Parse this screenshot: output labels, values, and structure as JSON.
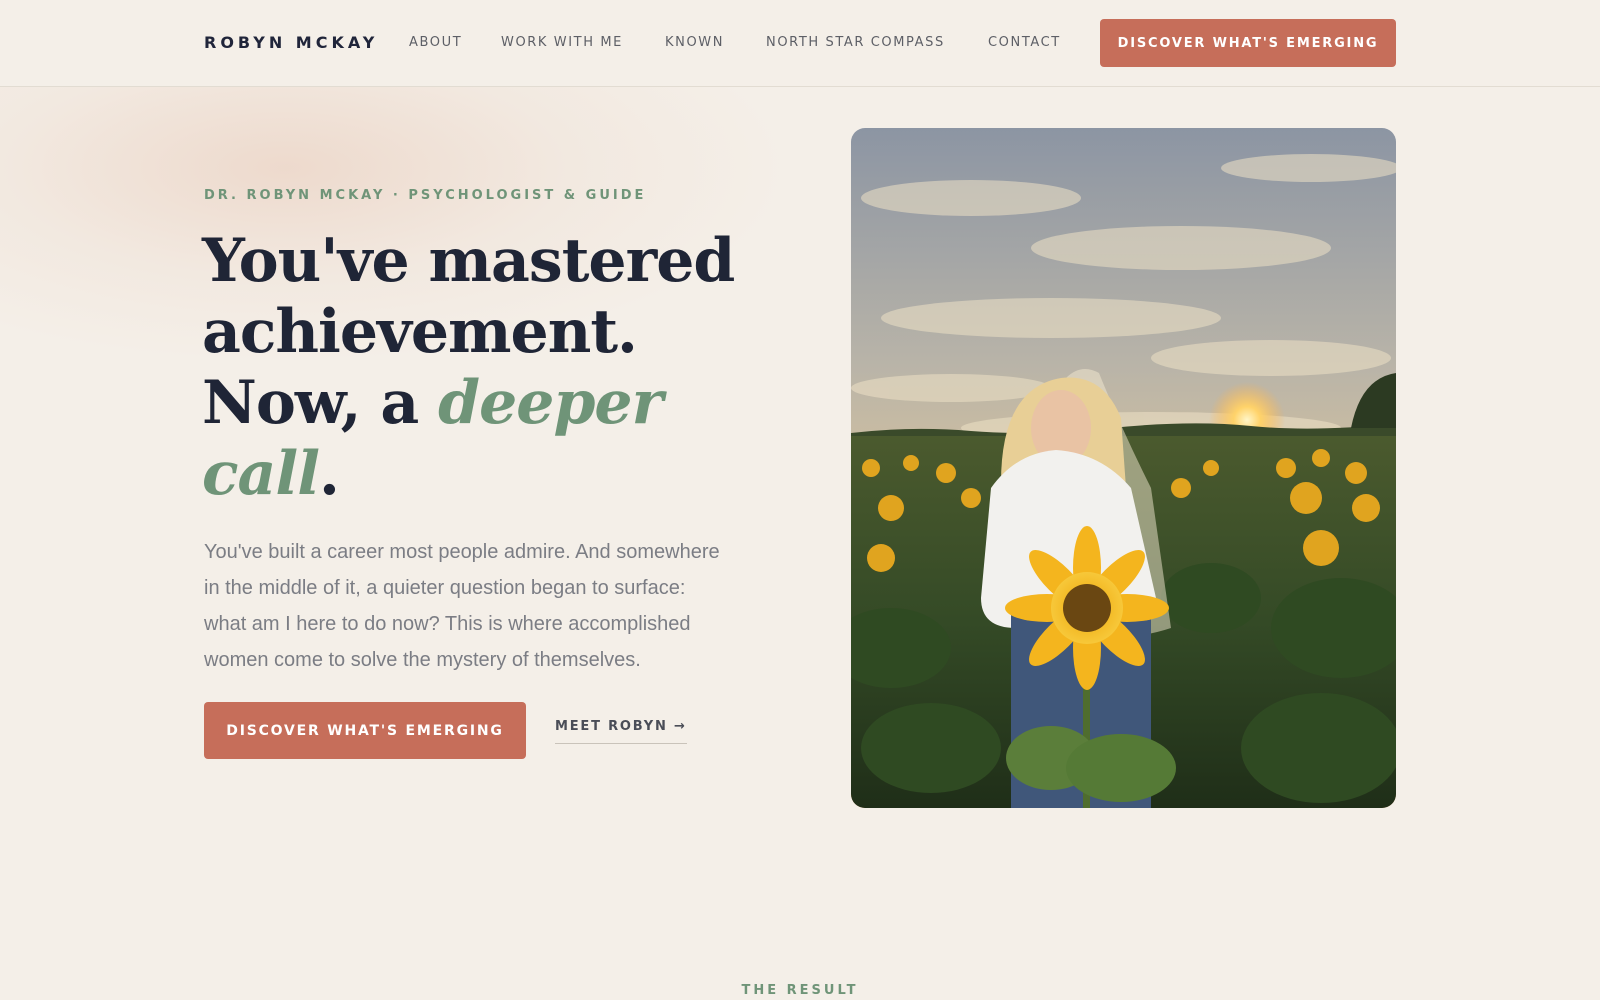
{
  "header": {
    "brand": "ROBYN MCKAY",
    "nav": [
      {
        "label": "ABOUT"
      },
      {
        "label": "WORK WITH ME"
      },
      {
        "label": "KNOWN"
      },
      {
        "label": "NORTH STAR COMPASS"
      },
      {
        "label": "CONTACT"
      }
    ],
    "cta_label": "DISCOVER WHAT'S EMERGING"
  },
  "hero": {
    "eyebrow": "DR. ROBYN MCKAY · PSYCHOLOGIST & GUIDE",
    "headline": {
      "line1": "You've mastered",
      "line2": "achievement.",
      "line3_start": "Now, a ",
      "accent1": "deeper",
      "accent2": "call",
      "end": "."
    },
    "lede": "You've built a career most people admire. And somewhere in the middle of it, a quieter question began to surface: what am I here to do now? This is where accomplished women come to solve the mystery of themselves.",
    "cta_label": "DISCOVER WHAT'S EMERGING",
    "secondary_link": "MEET ROBYN →",
    "photo_icon": "portrait-photo"
  },
  "next_section": {
    "label": "THE RESULT"
  },
  "colors": {
    "background": "#f4efe8",
    "accent_terracotta": "#c66e5a",
    "accent_sage": "#6f9478",
    "heading": "#1f2536"
  }
}
